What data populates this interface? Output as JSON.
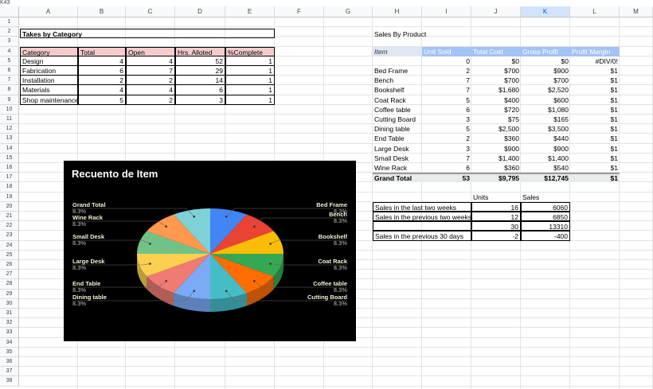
{
  "namebox": "K43",
  "columns": [
    "A",
    "B",
    "C",
    "D",
    "E",
    "F",
    "G",
    "H",
    "I",
    "J",
    "K",
    "L",
    "M"
  ],
  "rows": [
    "1",
    "2",
    "3",
    "4",
    "5",
    "6",
    "7",
    "8",
    "9",
    "10",
    "11",
    "12",
    "13",
    "14",
    "15",
    "16",
    "17",
    "18",
    "19",
    "20",
    "21",
    "22",
    "23",
    "24",
    "25",
    "26",
    "27",
    "28",
    "29",
    "30",
    "31",
    "32",
    "33",
    "34",
    "35",
    "36",
    "37",
    "38"
  ],
  "tasks": {
    "title": "Takes by Category",
    "headers": [
      "Category",
      "Total",
      "Open",
      "Hrs. Alloted",
      "%Complete"
    ],
    "rows": [
      [
        "Design",
        "4",
        "4",
        "52",
        "1"
      ],
      [
        "Fabrication",
        "6",
        "7",
        "29",
        "1"
      ],
      [
        "Installation",
        "2",
        "2",
        "14",
        "1"
      ],
      [
        "Materials",
        "4",
        "4",
        "6",
        "1"
      ],
      [
        "Shop maintenance",
        "5",
        "2",
        "3",
        "1"
      ]
    ]
  },
  "sales": {
    "title": "Sales By Product",
    "headers": [
      "Item",
      "Unit Sold",
      "Total Cost",
      "Gross Profit",
      "Profit Margin"
    ],
    "rows": [
      [
        "",
        "0",
        "$0",
        "$0",
        "#DIV/0!"
      ],
      [
        "Bed Frame",
        "2",
        "$700",
        "$900",
        "$1"
      ],
      [
        "Bench",
        "7",
        "$700",
        "$700",
        "$1"
      ],
      [
        "Bookshelf",
        "7",
        "$1,680",
        "$2,520",
        "$1"
      ],
      [
        "Coat Rack",
        "5",
        "$400",
        "$600",
        "$1"
      ],
      [
        "Coffee table",
        "6",
        "$720",
        "$1,080",
        "$1"
      ],
      [
        "Cutting Board",
        "3",
        "$75",
        "$165",
        "$1"
      ],
      [
        "Dining table",
        "5",
        "$2,500",
        "$3,500",
        "$1"
      ],
      [
        "End Table",
        "2",
        "$360",
        "$440",
        "$1"
      ],
      [
        "Large Desk",
        "3",
        "$900",
        "$900",
        "$1"
      ],
      [
        "Small Desk",
        "7",
        "$1,400",
        "$1,400",
        "$1"
      ],
      [
        "Wine Rack",
        "6",
        "$360",
        "$540",
        "$1"
      ]
    ],
    "total": [
      "Grand Total",
      "53",
      "$9,795",
      "$12,745",
      "$1"
    ]
  },
  "summary": {
    "headers": [
      "Units",
      "Sales"
    ],
    "rows": [
      [
        "Sales in the last two weeks",
        "16",
        "6060"
      ],
      [
        "Sales in the previous two weeks",
        "12",
        "6850"
      ],
      [
        "",
        "30",
        "13310"
      ],
      [
        "Sales in the previous 30 days",
        "-2",
        "-400"
      ]
    ]
  },
  "chart_data": {
    "type": "pie",
    "title": "Recuento de Item",
    "categories": [
      "Bed Frame",
      "Bench",
      "Bookshelf",
      "Coat Rack",
      "Coffee table",
      "Cutting Board",
      "Dining table",
      "End Table",
      "Large Desk",
      "Small Desk",
      "Wine Rack",
      "Grand Total"
    ],
    "values": [
      8.3,
      8.3,
      8.3,
      8.3,
      8.3,
      8.3,
      8.3,
      8.3,
      8.3,
      8.3,
      8.3,
      8.3
    ],
    "value_label": "8.3%",
    "colors": [
      "#4285f4",
      "#ea4335",
      "#fbbc04",
      "#34a853",
      "#ff6d01",
      "#46bdc6",
      "#7baaf7",
      "#f07b72",
      "#fcd04f",
      "#71c287",
      "#ff994d",
      "#7ed1d7"
    ],
    "background": "#000000"
  }
}
